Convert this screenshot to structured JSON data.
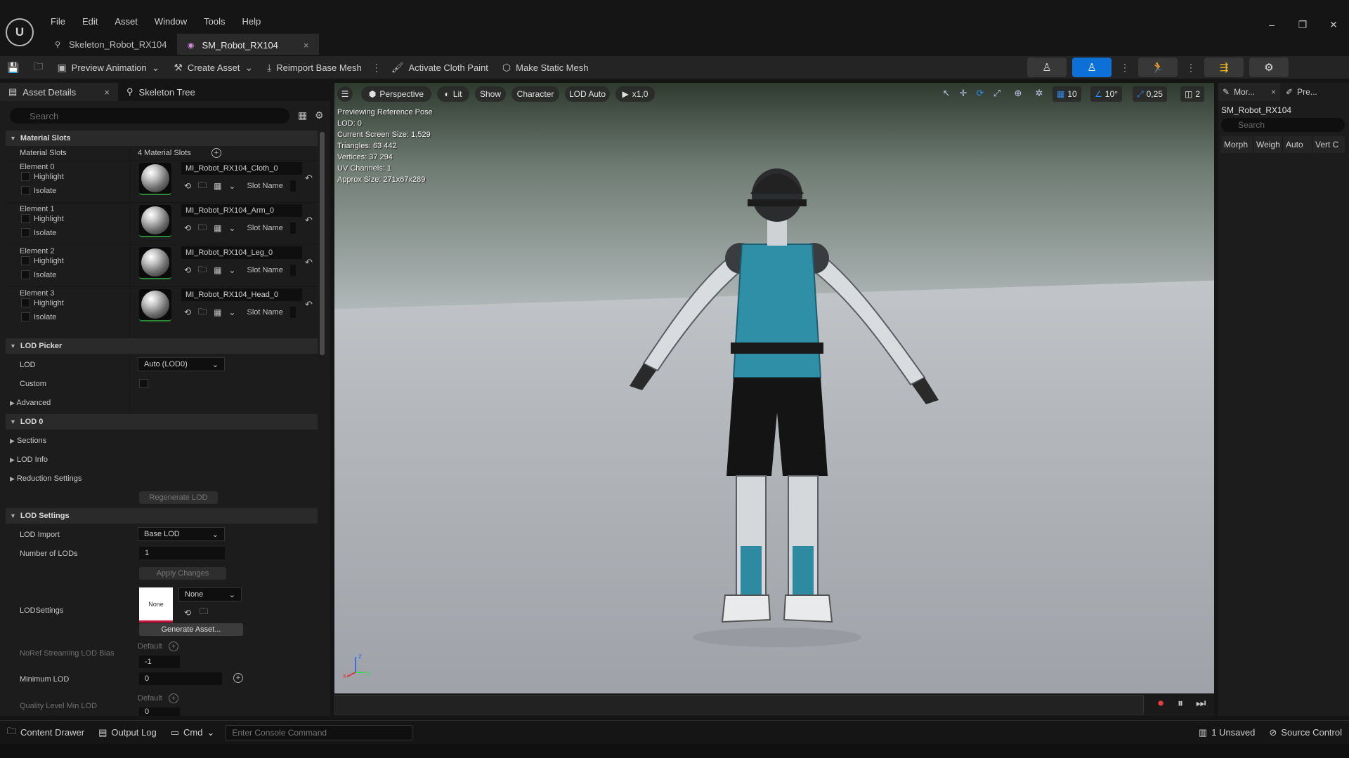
{
  "app": {
    "logo_text": "U",
    "menu": [
      "File",
      "Edit",
      "Asset",
      "Window",
      "Tools",
      "Help"
    ],
    "tabs": [
      {
        "label": "Skeleton_Robot_RX104",
        "icon": "skeleton-icon"
      },
      {
        "label": "SM_Robot_RX104",
        "icon": "skeletal-mesh-icon",
        "close": "×"
      }
    ],
    "window_controls": {
      "minimize": "–",
      "restore": "❐",
      "close": "✕"
    }
  },
  "toolbar": {
    "preview_animation": "Preview Animation",
    "create_asset": "Create Asset",
    "reimport_base_mesh": "Reimport Base Mesh",
    "activate_cloth_paint": "Activate Cloth Paint",
    "make_static_mesh": "Make Static Mesh",
    "accent_color": "#0d6fd8"
  },
  "left_panel": {
    "tabs": [
      {
        "label": "Asset Details",
        "close": "×"
      },
      {
        "label": "Skeleton Tree"
      }
    ],
    "search_placeholder": "Search",
    "material_slots_section": "Material Slots",
    "material_slots_label": "Material Slots",
    "material_slots_count": "4 Material Slots",
    "highlight_label": "Highlight",
    "isolate_label": "Isolate",
    "slot_name_label": "Slot Name",
    "elements": [
      {
        "label": "Element 0",
        "material": "MI_Robot_RX104_Cloth_0"
      },
      {
        "label": "Element 1",
        "material": "MI_Robot_RX104_Arm_0"
      },
      {
        "label": "Element 2",
        "material": "MI_Robot_RX104_Leg_0"
      },
      {
        "label": "Element 3",
        "material": "MI_Robot_RX104_Head_0"
      }
    ],
    "lod_picker_section": "LOD Picker",
    "lod_label": "LOD",
    "lod_value": "Auto (LOD0)",
    "custom_label": "Custom",
    "advanced_label": "Advanced",
    "lod0_section": "LOD 0",
    "sections_label": "Sections",
    "lod_info_label": "LOD Info",
    "reduction_settings_label": "Reduction Settings",
    "regenerate_lod": "Regenerate LOD",
    "lod_settings_section": "LOD Settings",
    "lod_import_label": "LOD Import",
    "lod_import_value": "Base LOD",
    "number_of_lods_label": "Number of LODs",
    "number_of_lods_value": "1",
    "apply_changes": "Apply Changes",
    "lodsettings_label": "LODSettings",
    "lodsettings_thumb": "None",
    "lodsettings_value": "None",
    "generate_asset": "Generate Asset...",
    "noref_label": "NoRef Streaming LOD Bias",
    "noref_default": "Default",
    "noref_value": "-1",
    "minimum_lod_label": "Minimum LOD",
    "minimum_lod_value": "0",
    "quality_label": "Quality Level Min LOD",
    "quality_default": "Default",
    "quality_value": "0"
  },
  "viewport": {
    "perspective": "Perspective",
    "lit": "Lit",
    "show": "Show",
    "character": "Character",
    "lod_auto": "LOD Auto",
    "play_speed": "x1,0",
    "grid_snap": "10",
    "angle_snap": "10°",
    "scale_snap": "0,25",
    "camera_speed": "2",
    "info": [
      "Previewing Reference Pose",
      "LOD: 0",
      "Current Screen Size: 1,529",
      "Triangles: 63 442",
      "Vertices: 37 294",
      "UV Channels: 1",
      "Approx Size: 271x67x289"
    ],
    "axis_labels": {
      "x": "x",
      "y": "y",
      "z": "z"
    }
  },
  "right_panel": {
    "tabs": [
      {
        "label": "Mor...",
        "close": "×"
      },
      {
        "label": "Pre..."
      }
    ],
    "asset_name": "SM_Robot_RX104",
    "search_placeholder": "Search",
    "columns": [
      "Morph",
      "Weigh",
      "Auto",
      "Vert C"
    ]
  },
  "statusbar": {
    "content_drawer": "Content Drawer",
    "output_log": "Output Log",
    "cmd": "Cmd",
    "console_placeholder": "Enter Console Command",
    "unsaved": "1 Unsaved",
    "source_control": "Source Control"
  }
}
